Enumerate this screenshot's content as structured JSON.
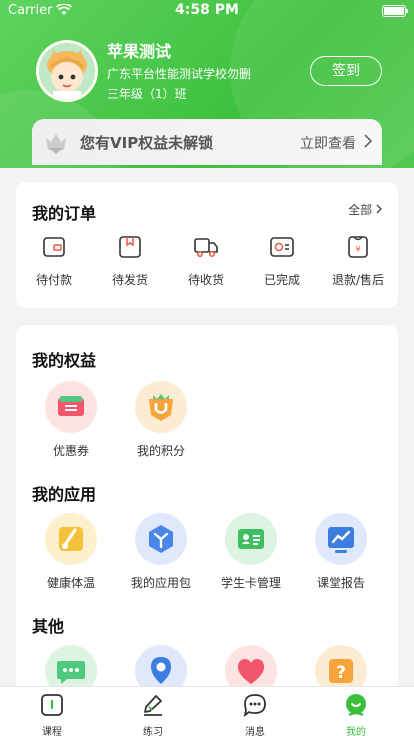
{
  "status_bar": {
    "carrier": "Carrier",
    "time": "4:58 PM"
  },
  "profile": {
    "name": "苹果测试",
    "school": "广东平台性能测试学校勿删",
    "class": "三年级（1）班",
    "signin_label": "签到"
  },
  "vip_banner": {
    "text": "您有VIP权益未解锁",
    "link": "立即查看"
  },
  "orders": {
    "title": "我的订单",
    "all_label": "全部",
    "items": [
      {
        "label": "待付款",
        "icon": "wallet-icon"
      },
      {
        "label": "待发货",
        "icon": "package-icon"
      },
      {
        "label": "待收货",
        "icon": "truck-icon"
      },
      {
        "label": "已完成",
        "icon": "check-card-icon"
      },
      {
        "label": "退款/售后",
        "icon": "refund-icon"
      }
    ]
  },
  "benefits": {
    "title": "我的权益",
    "items": [
      {
        "label": "优惠券",
        "icon": "coupon-icon"
      },
      {
        "label": "我的积分",
        "icon": "points-badge-icon"
      }
    ]
  },
  "apps": {
    "title": "我的应用",
    "items": [
      {
        "label": "健康体温",
        "icon": "thermometer-icon"
      },
      {
        "label": "我的应用包",
        "icon": "app-package-icon"
      },
      {
        "label": "学生卡管理",
        "icon": "student-card-icon"
      },
      {
        "label": "课堂报告",
        "icon": "report-chart-icon"
      }
    ]
  },
  "other": {
    "title": "其他",
    "items": [
      {
        "icon": "chat-bubble-icon"
      },
      {
        "icon": "location-pin-icon"
      },
      {
        "icon": "heart-icon"
      },
      {
        "icon": "question-icon"
      }
    ]
  },
  "tabbar": {
    "items": [
      {
        "label": "课程",
        "icon": "course-icon"
      },
      {
        "label": "练习",
        "icon": "pencil-icon"
      },
      {
        "label": "消息",
        "icon": "message-icon"
      },
      {
        "label": "我的",
        "icon": "profile-icon",
        "active": true
      }
    ]
  },
  "colors": {
    "brand_green": "#3ec13e",
    "active_tab": "#3cbf3c"
  }
}
